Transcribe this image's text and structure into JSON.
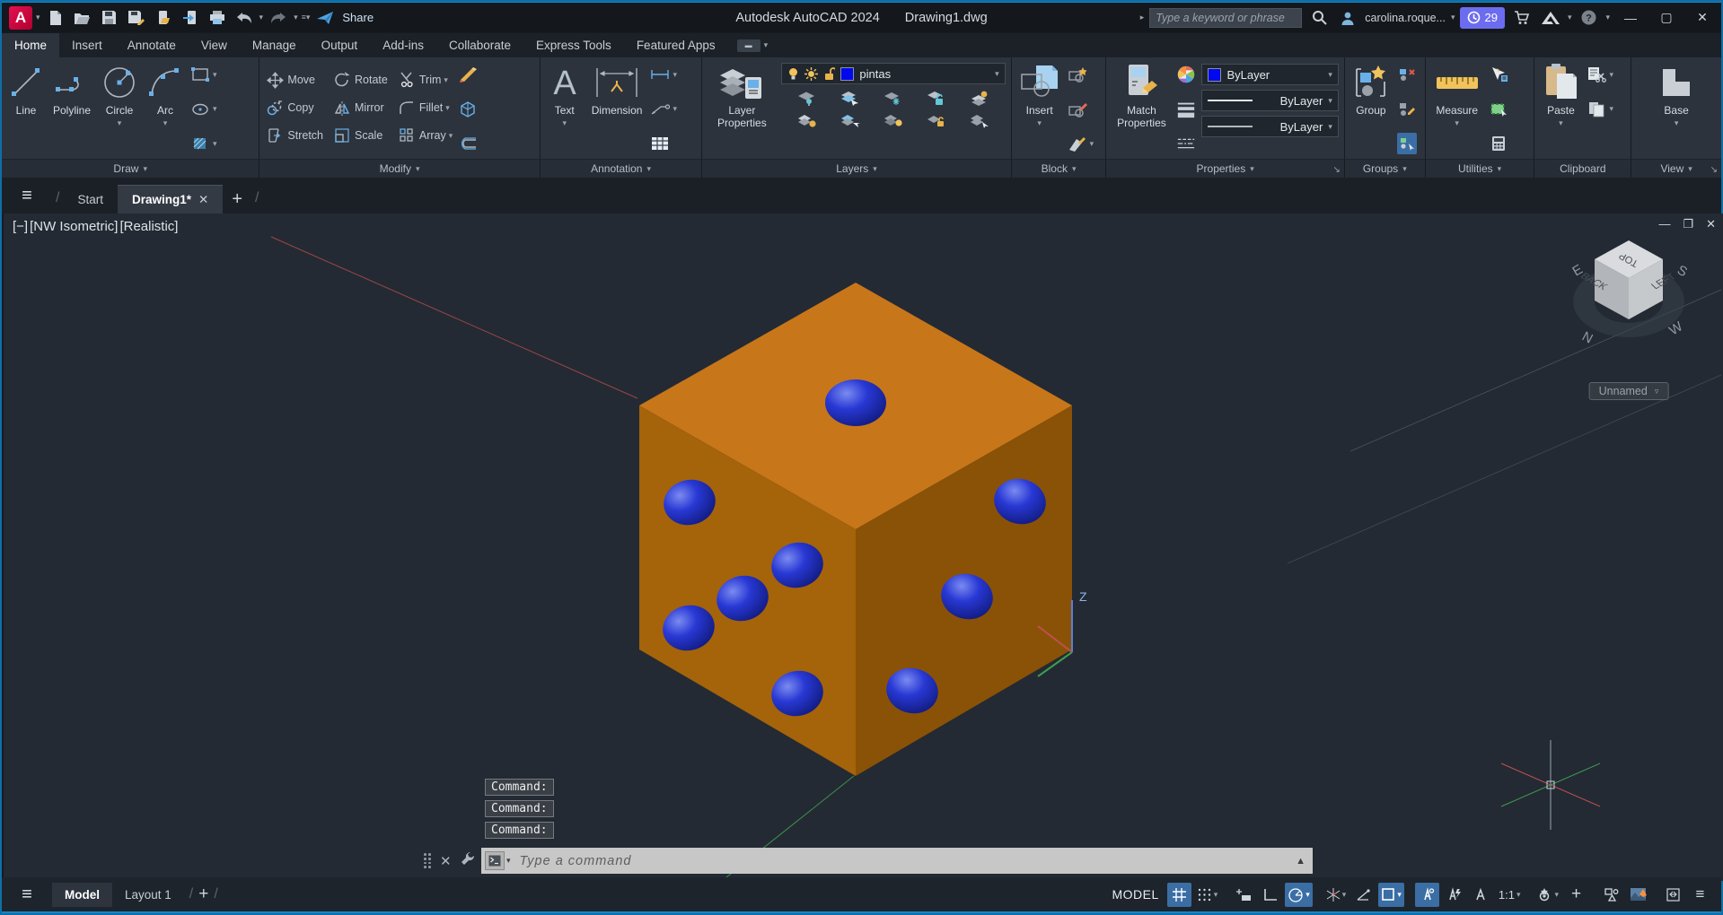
{
  "colors": {
    "accent_blue": "#1286c8",
    "ribbon_bg": "#2c333d",
    "viewport_bg": "#232a33",
    "highlight_button": "#3a6ea5",
    "trial_badge": "#6c6cf0",
    "dice_top": "#c8761a",
    "dice_left": "#a5630a",
    "dice_right": "#8a5206",
    "pip_blue": "#2433cc"
  },
  "titlebar": {
    "app_title": "Autodesk AutoCAD 2024",
    "doc_title": "Drawing1.dwg",
    "search_placeholder": "Type a keyword or phrase",
    "user": "carolina.roque...",
    "trial_days": "29",
    "share": "Share"
  },
  "ribbon": {
    "tabs": [
      {
        "label": "Home"
      },
      {
        "label": "Insert"
      },
      {
        "label": "Annotate"
      },
      {
        "label": "View"
      },
      {
        "label": "Manage"
      },
      {
        "label": "Output"
      },
      {
        "label": "Add-ins"
      },
      {
        "label": "Collaborate"
      },
      {
        "label": "Express Tools"
      },
      {
        "label": "Featured Apps"
      }
    ],
    "panels": {
      "draw": {
        "label": "Draw",
        "items": [
          "Line",
          "Polyline",
          "Circle",
          "Arc"
        ]
      },
      "modify": {
        "label": "Modify",
        "items": [
          "Move",
          "Rotate",
          "Trim",
          "Copy",
          "Mirror",
          "Fillet",
          "Stretch",
          "Scale",
          "Array"
        ]
      },
      "annotation": {
        "label": "Annotation",
        "items": [
          "Text",
          "Dimension"
        ]
      },
      "layers": {
        "label": "Layers",
        "button": "Layer Properties",
        "current_layer": "pintas"
      },
      "block": {
        "label": "Block",
        "button": "Insert"
      },
      "properties": {
        "label": "Properties",
        "button_line1": "Match",
        "button_line2": "Properties",
        "color": "ByLayer",
        "lineweight": "ByLayer",
        "linetype": "ByLayer"
      },
      "groups": {
        "label": "Groups",
        "button": "Group"
      },
      "utilities": {
        "label": "Utilities",
        "button": "Measure"
      },
      "clipboard": {
        "label": "Clipboard",
        "button": "Paste"
      },
      "view": {
        "label": "View",
        "button": "Base"
      }
    }
  },
  "file_tabs": {
    "start": "Start",
    "drawing": "Drawing1*"
  },
  "viewport": {
    "controls": "[−]",
    "view_name": "[NW Isometric]",
    "visual_style": "[Realistic]",
    "viewcube": {
      "top": "TOP",
      "left_face": "BACK",
      "right_face": "LEFT",
      "n": "N",
      "s": "S",
      "w": "W",
      "e": "E",
      "preset": "Unnamed"
    },
    "ucs_z_label": "Z"
  },
  "command": {
    "history": [
      "Command:",
      "Command:",
      "Command:"
    ],
    "placeholder": "Type a command"
  },
  "statusbar": {
    "model_tab": "Model",
    "layout_tab": "Layout 1",
    "mode_label": "MODEL",
    "annotation_scale": "1:1"
  },
  "scene": {
    "object": "3D dice: orange cube with blue spherical pips, NW isometric view",
    "faces": {
      "top_pips": 1,
      "left_pips": 5,
      "right_pips": 3
    }
  }
}
